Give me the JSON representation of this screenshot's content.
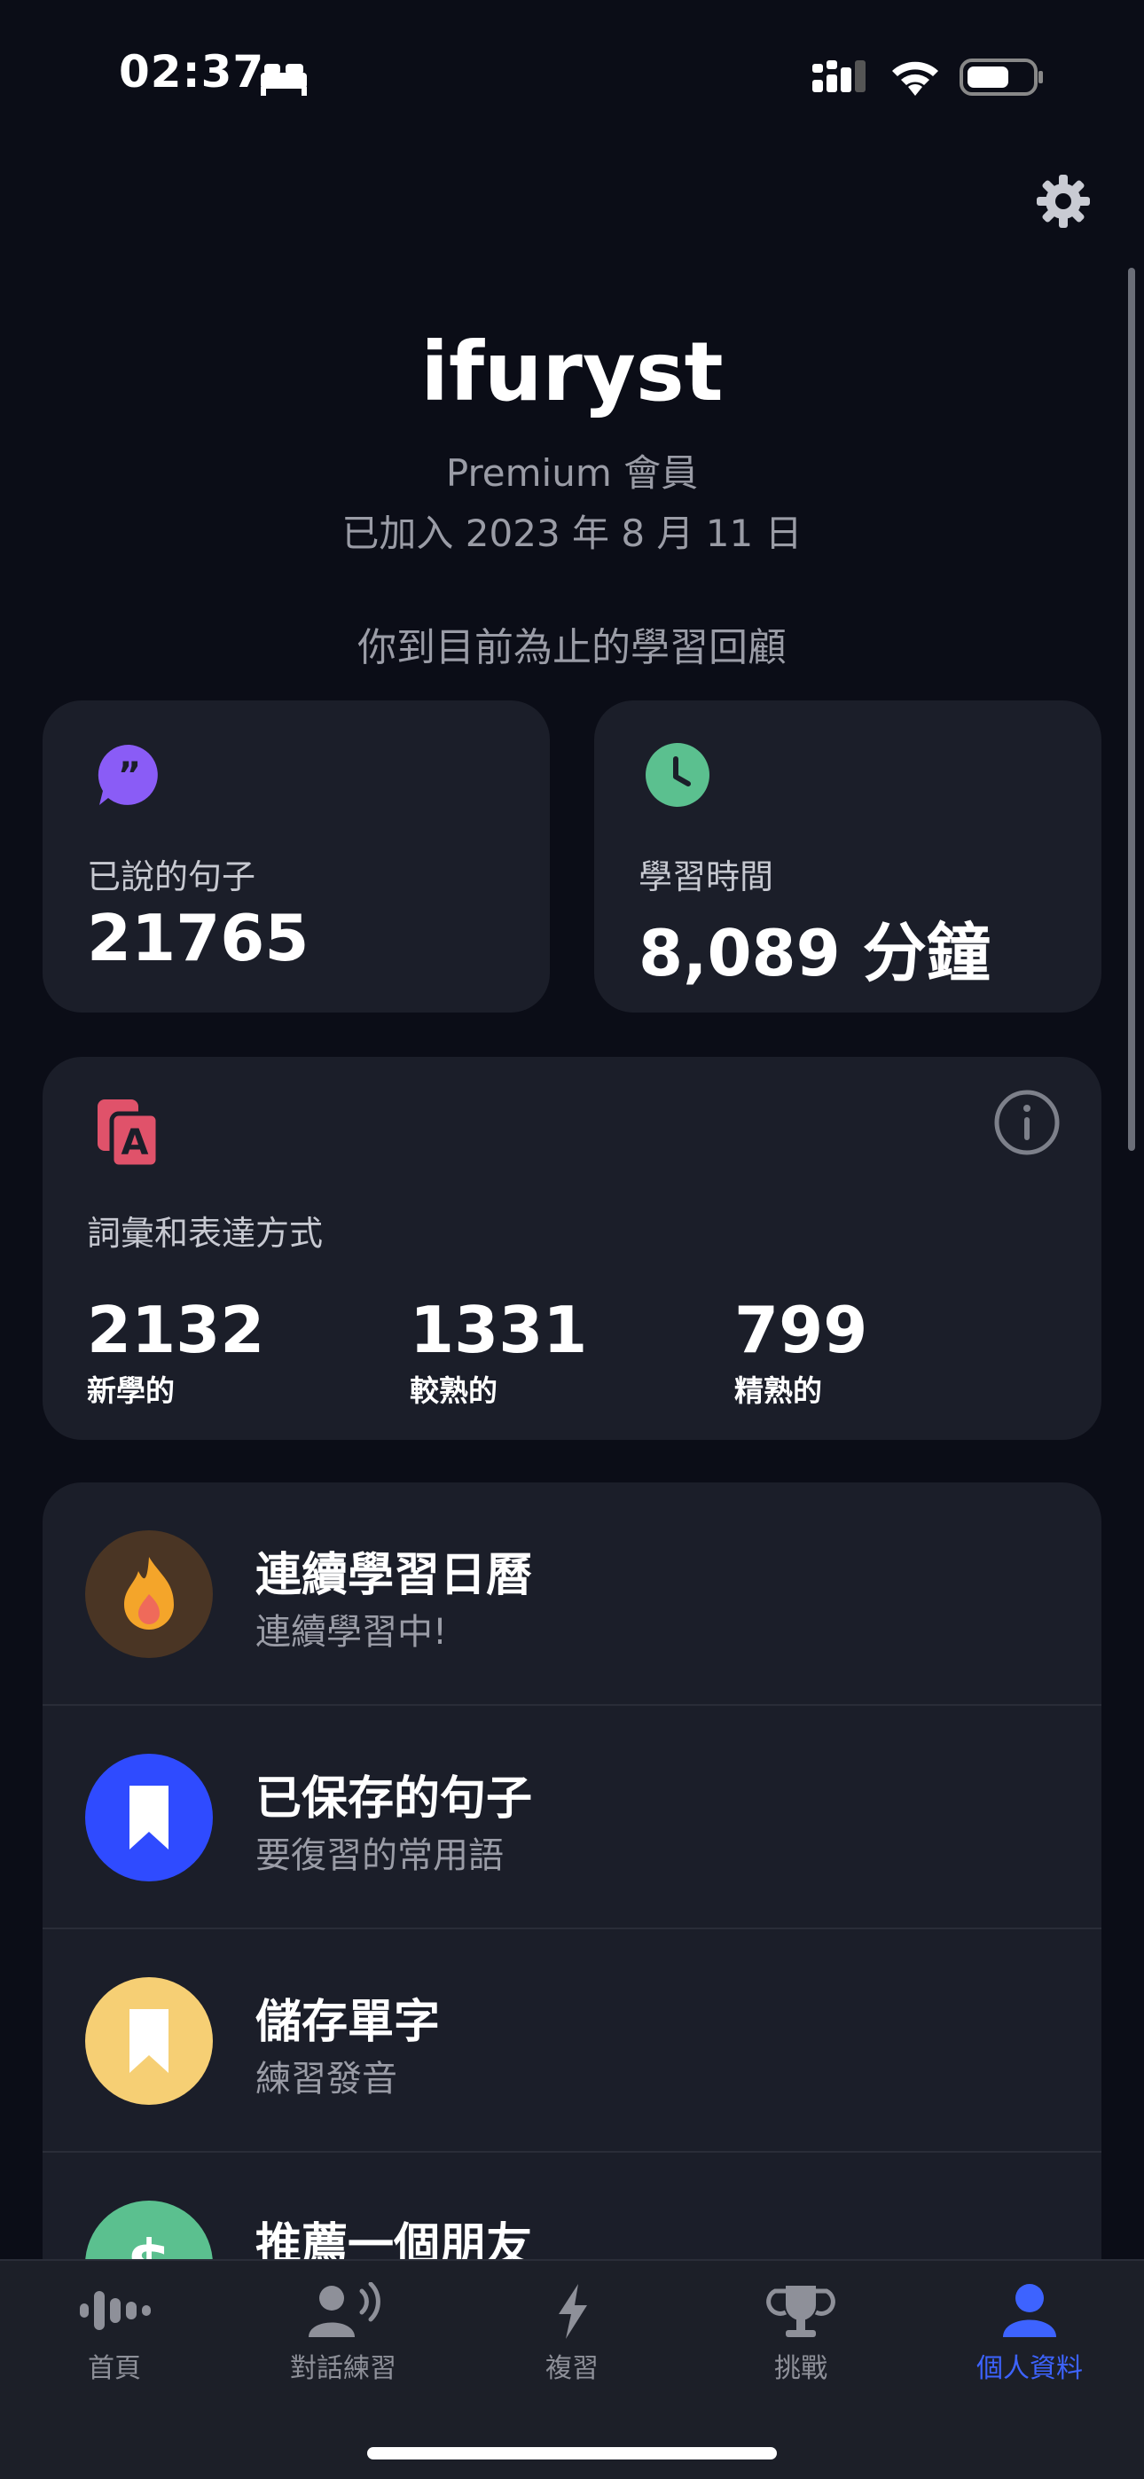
{
  "status_bar": {
    "time": "02:37"
  },
  "profile": {
    "username": "ifuryst",
    "tier": "Premium 會員",
    "joined": "已加入 2023 年 8 月 11 日"
  },
  "review_heading": "你到目前為止的學習回顧",
  "stats": {
    "sentences": {
      "label": "已說的句子",
      "value": "21765"
    },
    "time": {
      "label": "學習時間",
      "value": "8,089 分鐘"
    }
  },
  "vocab": {
    "title": "詞彙和表達方式",
    "items": [
      {
        "value": "2132",
        "caption": "新學的"
      },
      {
        "value": "1331",
        "caption": "較熟的"
      },
      {
        "value": "799",
        "caption": "精熟的"
      }
    ]
  },
  "menu": [
    {
      "title": "連續學習日曆",
      "subtitle": "連續學習中!",
      "icon": "flame-icon",
      "color": "#4a3524"
    },
    {
      "title": "已保存的句子",
      "subtitle": "要復習的常用語",
      "icon": "bookmark-icon",
      "color": "#2f4bff"
    },
    {
      "title": "儲存單字",
      "subtitle": "練習發音",
      "icon": "bookmark-icon",
      "color": "#f6cf74"
    },
    {
      "title": "推薦一個朋友",
      "subtitle": "",
      "icon": "dollar-icon",
      "color": "#5bc08f"
    }
  ],
  "tabs": [
    {
      "label": "首頁",
      "icon": "waveform-icon",
      "active": false
    },
    {
      "label": "對話練習",
      "icon": "speaking-person-icon",
      "active": false
    },
    {
      "label": "複習",
      "icon": "lightning-icon",
      "active": false
    },
    {
      "label": "挑戰",
      "icon": "trophy-icon",
      "active": false
    },
    {
      "label": "個人資料",
      "icon": "person-icon",
      "active": true
    }
  ],
  "colors": {
    "background": "#0b0d17",
    "card": "#1b1e29",
    "accent_blue": "#3d63ff",
    "quote_purple": "#8a5cf6",
    "clock_green": "#5bc08f",
    "vocab_red": "#e0526a"
  }
}
